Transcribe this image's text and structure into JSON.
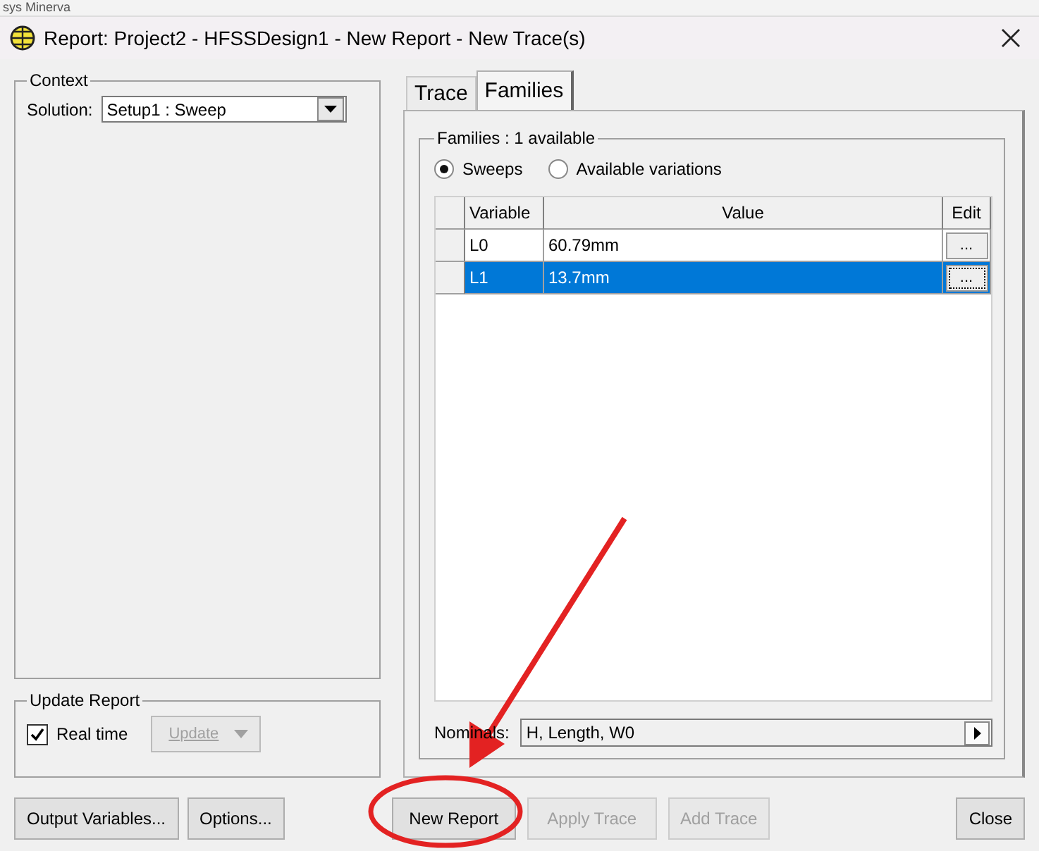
{
  "background_window": {
    "title": "sys Minerva"
  },
  "window": {
    "title": "Report: Project2 - HFSSDesign1 - New Report - New Trace(s)"
  },
  "context": {
    "legend": "Context",
    "solution_label": "Solution:",
    "solution_value": "Setup1 : Sweep"
  },
  "update_report": {
    "legend": "Update Report",
    "real_time": {
      "label": "Real time",
      "checked": true
    },
    "update_button": {
      "label": "Update",
      "disabled": true
    }
  },
  "tabs": [
    {
      "label": "Trace",
      "selected": false
    },
    {
      "label": "Families",
      "selected": true
    }
  ],
  "families": {
    "legend": "Families : 1 available",
    "radios": [
      {
        "label": "Sweeps",
        "selected": true
      },
      {
        "label": "Available variations",
        "selected": false
      }
    ],
    "columns": [
      "Variable",
      "Value",
      "Edit"
    ],
    "rows": [
      {
        "variable": "L0",
        "value": "60.79mm",
        "edit": "...",
        "selected": false
      },
      {
        "variable": "L1",
        "value": "13.7mm",
        "edit": "...",
        "selected": true
      }
    ],
    "nominals_label": "Nominals:",
    "nominals_value": "H, Length, W0"
  },
  "buttons": [
    {
      "label": "Output Variables...",
      "disabled": false
    },
    {
      "label": "Options...",
      "disabled": false
    },
    {
      "label": "New Report",
      "disabled": false
    },
    {
      "label": "Apply Trace",
      "disabled": true
    },
    {
      "label": "Add Trace",
      "disabled": true
    },
    {
      "label": "Close",
      "disabled": false
    }
  ]
}
